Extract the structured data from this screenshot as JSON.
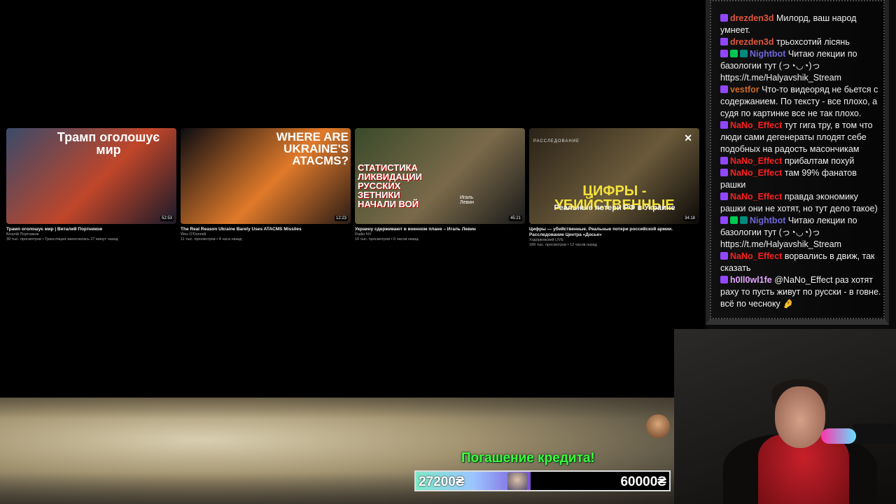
{
  "videos": [
    {
      "thumb_text": "Трамп оголошує мир",
      "duration": "52:53",
      "title": "Трамп оголошує мир | Виталий Портников",
      "channel": "Віталій Портников",
      "stats": "39 тыс. просмотров • Трансляция закончилась 27 минут назад",
      "colors": [
        "#3a4a6a",
        "#c0462a",
        "#1a1a2a"
      ]
    },
    {
      "thumb_text": "WHERE ARE UKRAINE'S ATACMS?",
      "duration": "12:23",
      "title": "The Real Reason Ukraine Barely Uses ATACMS Missiles",
      "channel": "Wes O'Donnell",
      "stats": "11 тыс. просмотров • 4 часа назад",
      "colors": [
        "#0c0c12",
        "#e07a2a",
        "#2a1c16"
      ]
    },
    {
      "thumb_text": "СТАТИСТИКА ЛИКВИДАЦИИ РУССКИХ ЗЕТНИКИ НАЧАЛИ ВОЙ",
      "caption": "Игаль Левин",
      "duration": "45:21",
      "title": "Украину сдерживают в военном плане – Игаль Левин",
      "channel": "Radio NV",
      "stats": "16 тыс. просмотров • 6 часов назад",
      "colors": [
        "#3a4a2a",
        "#7a6a4a",
        "#1a1a1a"
      ]
    },
    {
      "thumb_text": "ЦИФРЫ - УБИЙСТВЕННЫЕ",
      "sub_text": "Реальные потери РФ в Украине",
      "tag": "РАССЛЕДОВАНИЕ",
      "duration": "34:18",
      "title": "Цифры — убийственные. Реальные потери российской армии. Расследование Центра «Досье»",
      "channel": "Ходорковский LIVE",
      "stats": "189 тыс. просмотров • 12 часов назад",
      "colors": [
        "#2a2218",
        "#6a5a3a",
        "#0c0a08"
      ]
    }
  ],
  "close_label": "✕",
  "chat": [
    {
      "badges": [
        "sub"
      ],
      "user": "drezden3d",
      "ucls": "u-dre",
      "text": "Милорд, ваш народ умнеет."
    },
    {
      "badges": [
        "sub"
      ],
      "user": "drezden3d",
      "ucls": "u-dre",
      "text": "трьохсотий лісянь"
    },
    {
      "badges": [
        "sub",
        "green",
        "teal"
      ],
      "user": "Nightbot",
      "ucls": "u-night",
      "text": "Читаю лекции по базологии тут (っ◔◡◔)っ https://t.me/Halyavshik_Stream"
    },
    {
      "badges": [
        "sub"
      ],
      "user": "vestfor",
      "ucls": "u-vest",
      "text": "Что-то видеоряд не бьется с содержанием. По тексту - все плохо, а судя по картинке все не так плохо."
    },
    {
      "badges": [
        "sub"
      ],
      "user": "NaNo_Effect",
      "ucls": "u-nano",
      "text": "тут гига тру, в том что люди сами дегенераты плодят себе подобных на радость масончикам"
    },
    {
      "badges": [
        "sub"
      ],
      "user": "NaNo_Effect",
      "ucls": "u-nano",
      "text": "прибалтам похуй"
    },
    {
      "badges": [
        "sub"
      ],
      "user": "NaNo_Effect",
      "ucls": "u-nano",
      "text": "там 99% фанатов рашки"
    },
    {
      "badges": [
        "sub"
      ],
      "user": "NaNo_Effect",
      "ucls": "u-nano",
      "text": "правда экономику рашки они не хотят, но тут дело такое)"
    },
    {
      "badges": [
        "sub",
        "green",
        "teal"
      ],
      "user": "Nightbot",
      "ucls": "u-night",
      "text": "Читаю лекции по базологии тут (っ◔◡◔)っ https://t.me/Halyavshik_Stream"
    },
    {
      "badges": [
        "sub"
      ],
      "user": "NaNo_Effect",
      "ucls": "u-nano",
      "text": "ворвались в движ, так сказать"
    },
    {
      "badges": [
        "sub"
      ],
      "user": "h0ll0wl1fe",
      "ucls": "u-holl",
      "text": "@NaNo_Effect раз хотят раху то пусть живут по русски - в говне. всё по чесноку 🤌"
    }
  ],
  "credit": {
    "title": "Погашение кредита!",
    "current": "27200₴",
    "goal": "60000₴",
    "progress": 0.453
  }
}
